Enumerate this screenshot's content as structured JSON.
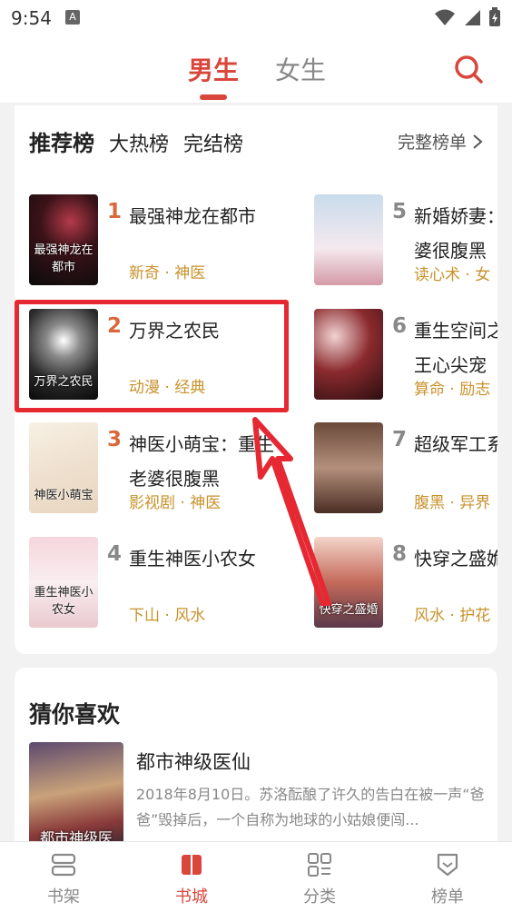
{
  "status": {
    "time": "9:54",
    "a_icon": "A"
  },
  "header": {
    "tabs": [
      {
        "label": "男生",
        "active": true
      },
      {
        "label": "女生",
        "active": false
      }
    ],
    "search_icon": "search-icon"
  },
  "ranking": {
    "tabs": [
      {
        "label": "推荐榜",
        "active": true
      },
      {
        "label": "大热榜"
      },
      {
        "label": "完结榜"
      }
    ],
    "full_list": "完整榜单",
    "books": [
      {
        "rank": "1",
        "title": "最强神龙在都市",
        "tags": "新奇 · 神医",
        "cover_text": "最强神龙在都市"
      },
      {
        "rank": "2",
        "title": "万界之农民",
        "tags": "动漫 · 经典",
        "cover_text": "万界之农民"
      },
      {
        "rank": "3",
        "title": "神医小萌宝：重生",
        "title2": "老婆很腹黑",
        "tags": "影视剧 · 神医",
        "cover_text": "神医小萌宝"
      },
      {
        "rank": "4",
        "title": "重生神医小农女",
        "tags": "下山 · 风水",
        "cover_text": "重生神医小农女"
      },
      {
        "rank": "5",
        "title": "新婚娇妻：",
        "title2": "婆很腹黑",
        "tags": "读心术 · 女"
      },
      {
        "rank": "6",
        "title": "重生空间之",
        "title2": "王心尖宠",
        "tags": "算命 · 励志"
      },
      {
        "rank": "7",
        "title": "超级军工系",
        "tags": "腹黑 · 异界"
      },
      {
        "rank": "8",
        "title": "快穿之盛姽",
        "tags": "风水 · 护花",
        "cover_text": "快穿之盛婚"
      }
    ]
  },
  "guess": {
    "title": "猜你喜欢",
    "book": {
      "title": "都市神级医仙",
      "desc": "2018年8月10日。苏洛酝酿了许久的告白在被一声“爸爸”毁掉后，一个自称为地球的小姑娘便闯...",
      "cover_text": "都市神级医"
    }
  },
  "nav": [
    {
      "label": "书架",
      "icon": "bookshelf-icon",
      "active": false
    },
    {
      "label": "书城",
      "icon": "book-city-icon",
      "active": true
    },
    {
      "label": "分类",
      "icon": "category-icon",
      "active": false
    },
    {
      "label": "榜单",
      "icon": "ranking-icon",
      "active": false
    }
  ],
  "colors": {
    "accent": "#d9463b",
    "tag": "#c8922c",
    "highlight": "#e52832"
  }
}
